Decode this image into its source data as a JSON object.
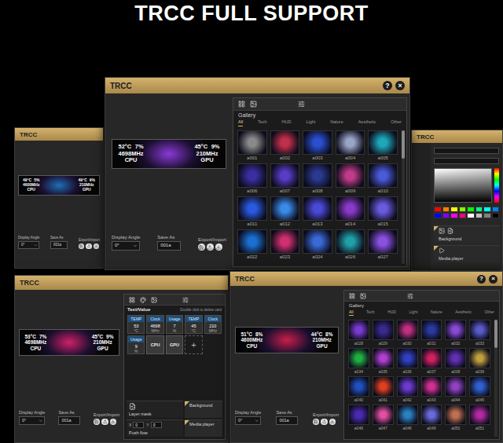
{
  "heading": "TRCC FULL SUPPORT",
  "windows": [
    {
      "kind": "compact",
      "title": "TRCC",
      "controls": [],
      "preview": {
        "color": "#1f6fb8",
        "sensors": [
          {
            "temp": "49°C",
            "usage": "5%",
            "clock": "4600MHz",
            "label": "CPU"
          },
          {
            "temp": "49°C",
            "usage": "9%",
            "clock": "210MHz",
            "label": "GPU"
          }
        ]
      },
      "display_angle": {
        "label": "Display Angle",
        "value": "0°"
      },
      "save": {
        "label": "Save As",
        "value": "001a",
        "export_label": "Export/Import"
      }
    },
    {
      "kind": "color",
      "title": "TRCC",
      "controls": [],
      "color_panel": {
        "swatches": [
          {
            "color": "#ff0000"
          },
          {
            "color": "#ff8000"
          },
          {
            "color": "#ffff00"
          },
          {
            "color": "#80ff00"
          },
          {
            "color": "#00ff00"
          },
          {
            "color": "#00ff80"
          },
          {
            "color": "#00ffff"
          },
          {
            "color": "#0080ff"
          },
          {
            "color": "#0000ff"
          },
          {
            "color": "#8000ff"
          },
          {
            "color": "#ff00ff"
          },
          {
            "color": "#ff0080"
          },
          {
            "color": "#ffffff"
          },
          {
            "color": "#c0c0c0"
          },
          {
            "color": "#808080"
          },
          {
            "color": "#000000"
          }
        ]
      },
      "sections": [
        {
          "label": "Background"
        },
        {
          "label": "Media player"
        }
      ]
    },
    {
      "kind": "gallery",
      "title": "TRCC",
      "controls": [
        "?",
        "×"
      ],
      "preview": {
        "color": "#8a3ad8",
        "sensors": [
          {
            "temp": "52°C",
            "usage": "7%",
            "clock": "4698MHz",
            "label": "CPU"
          },
          {
            "temp": "45°C",
            "usage": "9%",
            "clock": "210MHz",
            "label": "GPU"
          }
        ]
      },
      "display_angle": {
        "label": "Display Angle",
        "value": "0°"
      },
      "save": {
        "label": "Save As",
        "value": "001a",
        "export_label": "Export/Import"
      },
      "gallery": {
        "heading": "Gallery",
        "categories": [
          {
            "label": "All",
            "selected": true
          },
          {
            "label": "Tech",
            "selected": false
          },
          {
            "label": "HUD",
            "selected": false
          },
          {
            "label": "Light",
            "selected": false
          },
          {
            "label": "Nature",
            "selected": false
          },
          {
            "label": "Aesthetic",
            "selected": false
          },
          {
            "label": "Other",
            "selected": false
          }
        ],
        "items": [
          {
            "label": "a001",
            "color": "#8a8a8a"
          },
          {
            "label": "a002",
            "color": "#c0304a"
          },
          {
            "label": "a003",
            "color": "#2a4fd0"
          },
          {
            "label": "a004",
            "color": "#9aa6c8"
          },
          {
            "label": "a005",
            "color": "#1fa6b8"
          },
          {
            "label": "a006",
            "color": "#3a2fa0"
          },
          {
            "label": "a007",
            "color": "#5a3cc8"
          },
          {
            "label": "a008",
            "color": "#2a3a90"
          },
          {
            "label": "a009",
            "color": "#c03c8a"
          },
          {
            "label": "a010",
            "color": "#4a5ad8"
          },
          {
            "label": "a011",
            "color": "#2a5ae0"
          },
          {
            "label": "a012",
            "color": "#3a8ae8"
          },
          {
            "label": "a013",
            "color": "#4a4ad8"
          },
          {
            "label": "a014",
            "color": "#8a3ac8"
          },
          {
            "label": "a015",
            "color": "#6a5ae0"
          },
          {
            "label": "a022",
            "color": "#1a70d0"
          },
          {
            "label": "a023",
            "color": "#d03070"
          },
          {
            "label": "a024",
            "color": "#3a6ad8"
          },
          {
            "label": "a026",
            "color": "#20a0a8"
          },
          {
            "label": "a027",
            "color": "#8a50e0"
          }
        ]
      }
    },
    {
      "kind": "editor",
      "title": "TRCC",
      "controls": [],
      "preview": {
        "color": "#d0206a",
        "sensors": [
          {
            "temp": "53°C",
            "usage": "7%",
            "clock": "4698MHz",
            "label": "CPU"
          },
          {
            "temp": "45°C",
            "usage": "9%",
            "clock": "210MHz",
            "label": "GPU"
          }
        ]
      },
      "display_angle": {
        "label": "Display Angle",
        "value": "0°"
      },
      "save": {
        "label": "Save As",
        "value": "001a",
        "export_label": "Export/Import"
      },
      "editor": {
        "heading": "Text/Value",
        "hint": "Double click to delete card",
        "add": "+",
        "cards": [
          {
            "kind": "value",
            "label": "TEMP",
            "value": "53",
            "unit": "°C"
          },
          {
            "kind": "value",
            "label": "Clock",
            "value": "4698",
            "unit": "MHz"
          },
          {
            "kind": "value",
            "label": "Usage",
            "value": "7",
            "unit": "%"
          },
          {
            "kind": "value",
            "label": "TEMP",
            "value": "45",
            "unit": "°C"
          },
          {
            "kind": "value",
            "label": "Clock",
            "value": "210",
            "unit": "MHz"
          },
          {
            "kind": "value",
            "label": "Usage",
            "value": "9",
            "unit": "%"
          },
          {
            "kind": "source",
            "label": "CPU"
          },
          {
            "kind": "source",
            "label": "GPU"
          }
        ],
        "sections": [
          {
            "kind": "mask",
            "label": "Layer mask"
          },
          {
            "kind": "tab",
            "label": "Background"
          },
          {
            "kind": "flow",
            "label": "Push flow",
            "fields": [
              {
                "label": "X",
                "value": "0"
              },
              {
                "label": "Y",
                "value": "0"
              }
            ]
          },
          {
            "kind": "tab",
            "label": "Media player"
          }
        ]
      }
    },
    {
      "kind": "gallery",
      "title": "TRCC",
      "controls": [
        "?",
        "×"
      ],
      "preview": {
        "color": "#c81e4a",
        "sensors": [
          {
            "temp": "51°C",
            "usage": "8%",
            "clock": "4600MHz",
            "label": "CPU"
          },
          {
            "temp": "44°C",
            "usage": "8%",
            "clock": "210MHz",
            "label": "GPU"
          }
        ]
      },
      "display_angle": {
        "label": "Display Angle",
        "value": "0°"
      },
      "save": {
        "label": "Save As",
        "value": "001a",
        "export_label": "Export/Import"
      },
      "gallery": {
        "heading": "Gallery",
        "categories": [
          {
            "label": "All",
            "selected": true
          },
          {
            "label": "Tech",
            "selected": false
          },
          {
            "label": "HUD",
            "selected": false
          },
          {
            "label": "Light",
            "selected": false
          },
          {
            "label": "Nature",
            "selected": false
          },
          {
            "label": "Aesthetic",
            "selected": false
          },
          {
            "label": "Other",
            "selected": false
          }
        ],
        "items": [
          {
            "label": "a028",
            "color": "#7a3ad0"
          },
          {
            "label": "a029",
            "color": "#3a2a90"
          },
          {
            "label": "a030",
            "color": "#c03080"
          },
          {
            "label": "a031",
            "color": "#2a3aa0"
          },
          {
            "label": "a032",
            "color": "#8a4ad8"
          },
          {
            "label": "a033",
            "color": "#5a5ac8"
          },
          {
            "label": "a034",
            "color": "#20b040"
          },
          {
            "label": "a035",
            "color": "#b040d0"
          },
          {
            "label": "a036",
            "color": "#3040c0"
          },
          {
            "label": "a037",
            "color": "#d02060"
          },
          {
            "label": "a038",
            "color": "#6030b0"
          },
          {
            "label": "a039",
            "color": "#c0a040"
          },
          {
            "label": "a040",
            "color": "#2050c0"
          },
          {
            "label": "a041",
            "color": "#e04020"
          },
          {
            "label": "a042",
            "color": "#6a3ad0"
          },
          {
            "label": "a043",
            "color": "#d03090"
          },
          {
            "label": "a044",
            "color": "#9040c0"
          },
          {
            "label": "a045",
            "color": "#3060d0"
          },
          {
            "label": "a046",
            "color": "#4a2ab0"
          },
          {
            "label": "a047",
            "color": "#e050a0"
          },
          {
            "label": "a048",
            "color": "#2a80c0"
          },
          {
            "label": "a049",
            "color": "#6a6ad8"
          },
          {
            "label": "a050",
            "color": "#c07050"
          },
          {
            "label": "a051",
            "color": "#b02aa0"
          }
        ]
      }
    }
  ]
}
